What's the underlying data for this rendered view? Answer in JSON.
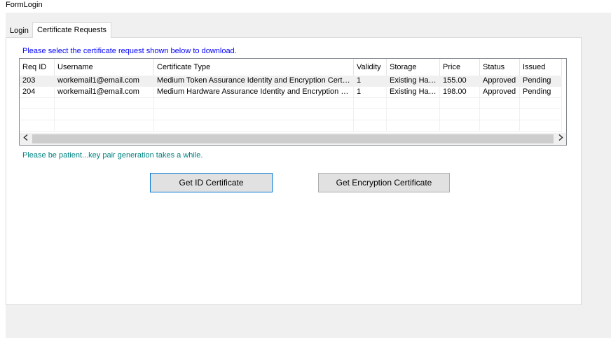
{
  "window": {
    "title": "FormLogin"
  },
  "tabs": [
    {
      "label": "Login",
      "active": false
    },
    {
      "label": "Certificate Requests",
      "active": true
    }
  ],
  "instruction": "Please select the certificate request shown below to download.",
  "grid": {
    "columns": [
      "Req ID",
      "Username",
      "Certificate Type",
      "Validity",
      "Storage",
      "Price",
      "Status",
      "Issued"
    ],
    "rows": [
      [
        "203",
        "workemail1@email.com",
        "Medium Token Assurance Identity and Encryption Certificate",
        "1",
        "Existing Har...",
        "155.00",
        "Approved",
        "Pending"
      ],
      [
        "204",
        "workemail1@email.com",
        "Medium Hardware Assurance Identity and Encryption Certifi...",
        "1",
        "Existing Har...",
        "198.00",
        "Approved",
        "Pending"
      ]
    ],
    "scroll_left_icon": "chevron-left-icon",
    "scroll_right_icon": "chevron-right-icon"
  },
  "status_message": "Please be patient...key pair generation takes a while.",
  "buttons": {
    "get_id": "Get ID Certificate",
    "get_encryption": "Get Encryption Certificate"
  },
  "colors": {
    "instruction": "#0000ff",
    "status_message": "#008080",
    "primary_border": "#0078d7"
  }
}
